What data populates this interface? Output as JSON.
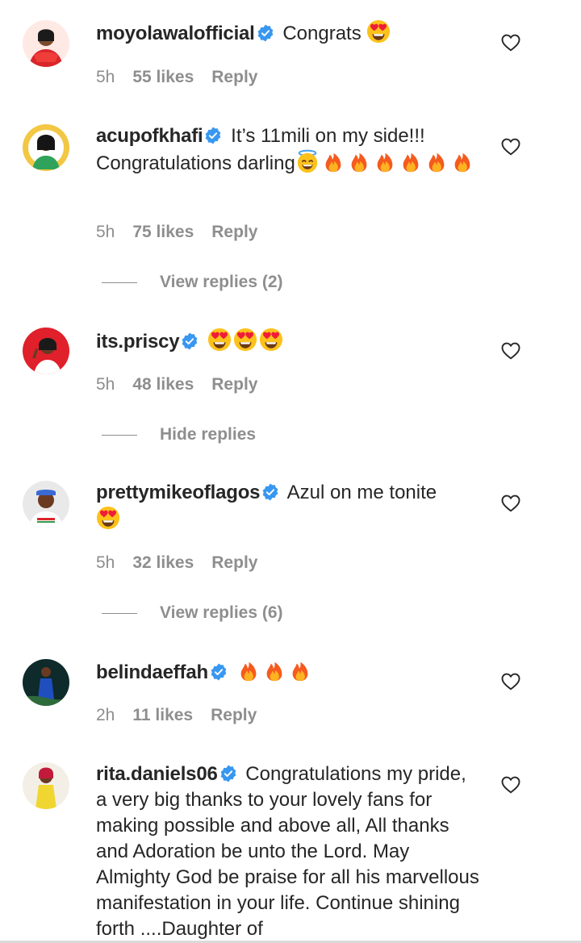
{
  "comments": [
    {
      "username": "moyolawalofficial",
      "text": "Congrats",
      "time": "5h",
      "likes": "55 likes",
      "reply": "Reply",
      "emojis": [
        "heart-eyes"
      ],
      "avatar_color": "#d83a3a"
    },
    {
      "username": "acupofkhafi",
      "text": "It’s 11mili on my side!!! Congratulations darling",
      "time": "5h",
      "likes": "75 likes",
      "reply": "Reply",
      "emojis": [
        "halo-smile",
        "fire",
        "fire",
        "fire",
        "fire",
        "fire",
        "fire"
      ],
      "avatar_color": "#f2c744",
      "replies_toggle": "View replies (2)"
    },
    {
      "username": "its.priscy",
      "text": "",
      "time": "5h",
      "likes": "48 likes",
      "reply": "Reply",
      "emojis": [
        "heart-eyes",
        "heart-eyes",
        "heart-eyes"
      ],
      "avatar_color": "#e0202a",
      "replies_toggle": "Hide replies"
    },
    {
      "username": "prettymikeoflagos",
      "text": "Azul on me tonite",
      "time": "5h",
      "likes": "32 likes",
      "reply": "Reply",
      "emojis": [
        "heart-eyes"
      ],
      "avatar_color": "#e9e9e9",
      "replies_toggle": "View replies (6)"
    },
    {
      "username": "belindaeffah",
      "text": "",
      "time": "2h",
      "likes": "11 likes",
      "reply": "Reply",
      "emojis": [
        "fire",
        "fire",
        "fire"
      ],
      "avatar_color": "#1f4fbf"
    },
    {
      "username": "rita.daniels06",
      "text": "Congratulations my pride, a very big thanks to your lovely fans for making possible and above all, All thanks and Adoration be unto the Lord. May Almighty God be praise for all his marvellous manifestation in your life. Continue shining forth ....Daughter of",
      "avatar_color": "#f0d630"
    }
  ],
  "icons": {
    "verified": "verified-badge-icon",
    "like": "heart-outline-icon"
  },
  "colors": {
    "text": "#262626",
    "secondary": "#8e8e8e",
    "verified": "#3897f0",
    "fire": "#f55a1e"
  }
}
